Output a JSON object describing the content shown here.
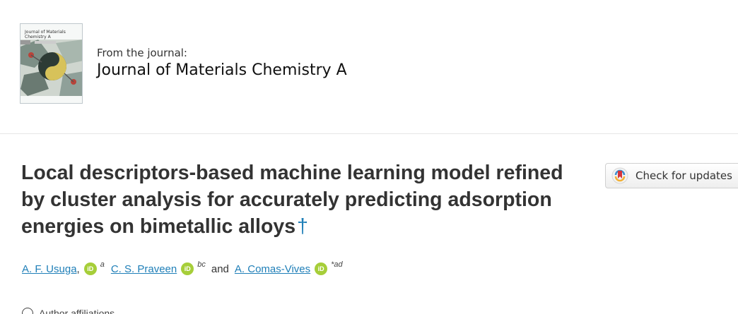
{
  "journal": {
    "cover_title": "Journal of Materials Chemistry A",
    "from_label": "From the journal:",
    "name": "Journal of Materials Chemistry A"
  },
  "article": {
    "title": "Local descriptors-based machine learning model refined by cluster analysis for accurately predicting adsorption energies on bimetallic alloys",
    "title_marker": "†"
  },
  "check_updates": {
    "label": "Check for updates",
    "icon": "crossmark-icon"
  },
  "authors": [
    {
      "name": "A. F. Usuga",
      "separator": ",",
      "affiliation": "a"
    },
    {
      "name": "C. S. Praveen",
      "affiliation": "bc"
    },
    {
      "name": "A. Comas-Vives",
      "affiliation": "*ad"
    }
  ],
  "authors_joiner": "and",
  "orcid_label": "iD",
  "affiliations_toggle": {
    "label": "Author affiliations"
  },
  "colors": {
    "link": "#1f7fb8",
    "orcid": "#a6ce39",
    "title": "#333333"
  }
}
